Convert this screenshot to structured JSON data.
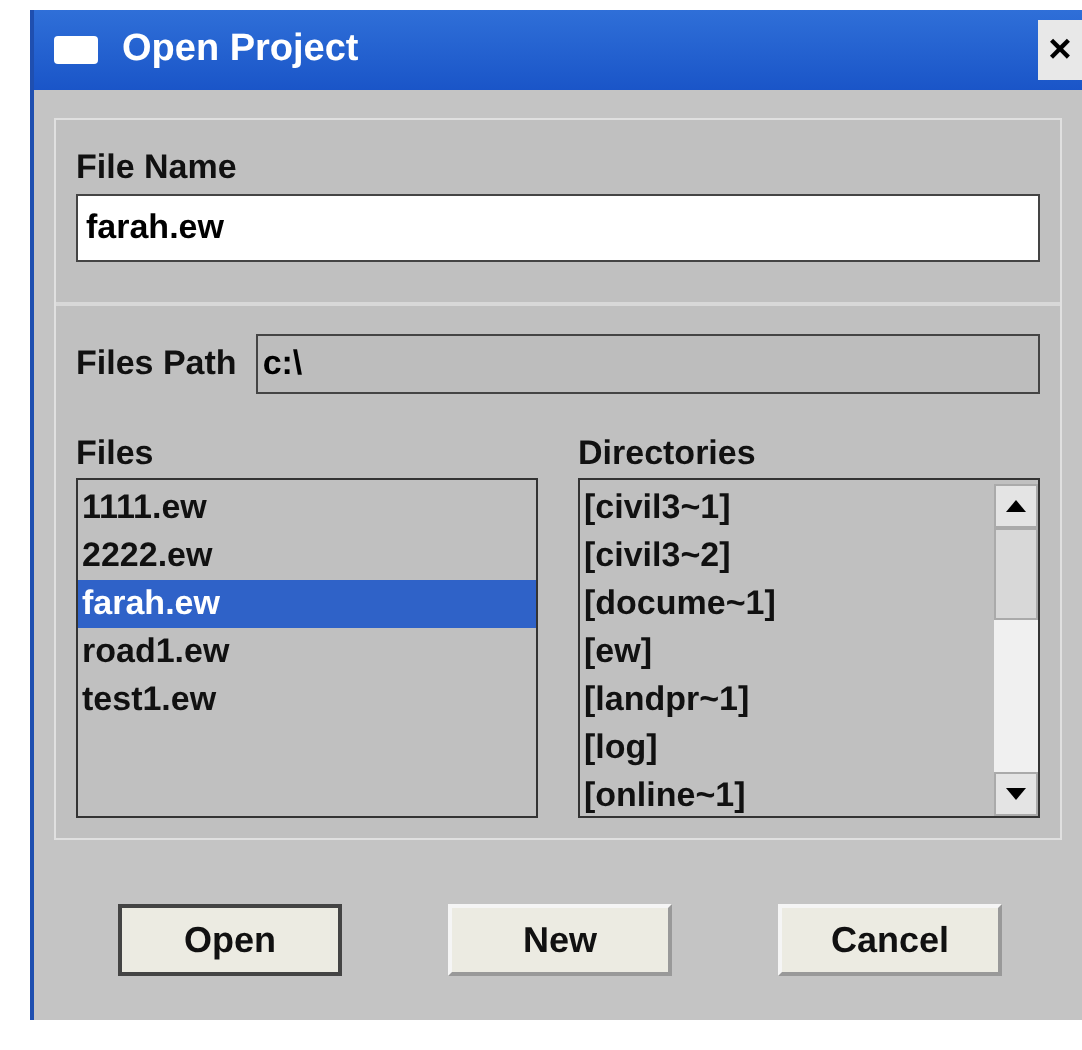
{
  "window": {
    "title": "Open Project",
    "close": "×"
  },
  "file_name": {
    "label": "File Name",
    "value": "farah.ew"
  },
  "files_path": {
    "label": "Files Path",
    "value": "c:\\"
  },
  "files": {
    "label": "Files",
    "items": [
      {
        "name": "1111.ew",
        "selected": false
      },
      {
        "name": "2222.ew",
        "selected": false
      },
      {
        "name": "farah.ew",
        "selected": true
      },
      {
        "name": "road1.ew",
        "selected": false
      },
      {
        "name": "test1.ew",
        "selected": false
      }
    ]
  },
  "directories": {
    "label": "Directories",
    "items": [
      "[civil3~1]",
      "[civil3~2]",
      "[docume~1]",
      "[ew]",
      "[landpr~1]",
      "[log]",
      "[online~1]"
    ]
  },
  "buttons": [
    {
      "label": "Open",
      "default": true
    },
    {
      "label": "New",
      "default": false
    },
    {
      "label": "Cancel",
      "default": false
    }
  ]
}
